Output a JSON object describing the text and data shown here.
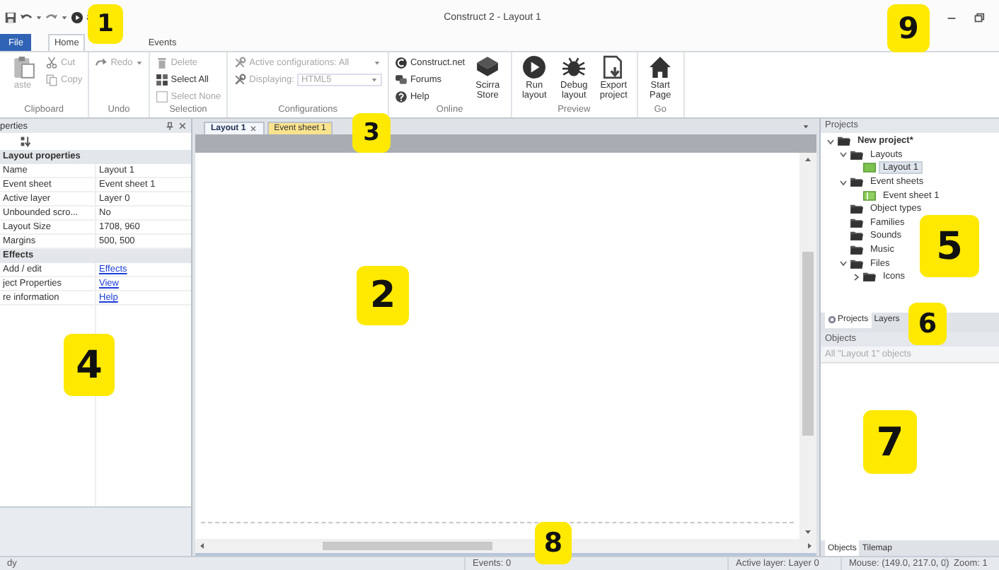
{
  "window": {
    "title": "Construct 2 - Layout 1"
  },
  "ribbon_tabs": [
    {
      "label": "File",
      "kind": "file",
      "selected": false
    },
    {
      "label": "Home",
      "kind": "tab",
      "selected": true
    },
    {
      "label": "Events",
      "kind": "tab",
      "selected": false
    }
  ],
  "ribbon_groups": [
    {
      "label": "Clipboard",
      "columns": [
        [
          {
            "label": "aste",
            "kind": "large",
            "disabled": true
          }
        ],
        [
          {
            "label": "Cut",
            "kind": "small",
            "disabled": true
          },
          {
            "label": "Copy",
            "kind": "small",
            "disabled": true
          }
        ]
      ]
    },
    {
      "label": "Undo",
      "columns": [
        [
          {
            "label": "Redo",
            "kind": "split",
            "disabled": true
          }
        ]
      ]
    },
    {
      "label": "Selection",
      "columns": [
        [
          {
            "label": "Delete",
            "kind": "small",
            "disabled": true
          },
          {
            "label": "Select All",
            "kind": "small",
            "disabled": false
          },
          {
            "label": "Select None",
            "kind": "small",
            "disabled": true
          }
        ]
      ]
    },
    {
      "label": "Configurations",
      "columns": [
        [
          {
            "label": "Active configurations: All",
            "kind": "dropdown",
            "disabled": true
          },
          {
            "label": "Displaying:",
            "value": "HTML5",
            "kind": "combo",
            "disabled": true
          }
        ]
      ]
    },
    {
      "label": "Online",
      "columns": [
        [
          {
            "label": "Construct.net",
            "kind": "small",
            "disabled": false
          },
          {
            "label": "Forums",
            "kind": "small",
            "disabled": false
          },
          {
            "label": "Help",
            "kind": "small",
            "disabled": false
          }
        ],
        [
          {
            "label": "Scirra Store",
            "kind": "large",
            "disabled": false
          }
        ]
      ]
    },
    {
      "label": "Preview",
      "columns": [
        [
          {
            "label": "Run layout",
            "kind": "large",
            "disabled": false
          }
        ],
        [
          {
            "label": "Debug layout",
            "kind": "large",
            "disabled": false
          }
        ],
        [
          {
            "label": "Export project",
            "kind": "large",
            "disabled": false
          }
        ]
      ]
    },
    {
      "label": "Go",
      "columns": [
        [
          {
            "label": "Start Page",
            "kind": "large",
            "disabled": false
          }
        ]
      ]
    }
  ],
  "properties_panel": {
    "title": "perties",
    "rows": [
      {
        "kind": "category",
        "name": "Layout properties"
      },
      {
        "kind": "property",
        "name": "Name",
        "value": "Layout 1"
      },
      {
        "kind": "property",
        "name": "Event sheet",
        "value": "Event sheet 1"
      },
      {
        "kind": "property",
        "name": "Active layer",
        "value": "Layer 0"
      },
      {
        "kind": "property",
        "name": "Unbounded scro...",
        "value": "No"
      },
      {
        "kind": "property",
        "name": "Layout Size",
        "value": "1708, 960"
      },
      {
        "kind": "property",
        "name": "Margins",
        "value": "500, 500"
      },
      {
        "kind": "category",
        "name": "Effects"
      },
      {
        "kind": "link",
        "name": "Add / edit",
        "value": "Effects"
      },
      {
        "kind": "link",
        "name": "ject Properties",
        "value": "View"
      },
      {
        "kind": "link",
        "name": "re information",
        "value": "Help"
      }
    ]
  },
  "document_tabs": [
    {
      "label": "Layout 1",
      "kind": "layout",
      "selected": true
    },
    {
      "label": "Event sheet 1",
      "kind": "event_sheet",
      "selected": false
    }
  ],
  "projects_panel": {
    "title": "Projects",
    "tree": [
      {
        "label": "New project*",
        "kind": "folder",
        "selected": false,
        "expanded": true,
        "children": [
          {
            "label": "Layouts",
            "kind": "folder",
            "selected": false,
            "expanded": true,
            "children": [
              {
                "label": "Layout 1",
                "kind": "layout",
                "selected": true
              }
            ]
          },
          {
            "label": "Event sheets",
            "kind": "folder",
            "selected": false,
            "expanded": true,
            "children": [
              {
                "label": "Event sheet 1",
                "kind": "event_sheet",
                "selected": false
              }
            ]
          },
          {
            "label": "Object types",
            "kind": "folder",
            "selected": false
          },
          {
            "label": "Families",
            "kind": "folder",
            "selected": false
          },
          {
            "label": "Sounds",
            "kind": "folder",
            "selected": false
          },
          {
            "label": "Music",
            "kind": "folder",
            "selected": false
          },
          {
            "label": "Files",
            "kind": "folder",
            "selected": false,
            "expanded": true,
            "children": [
              {
                "label": "Icons",
                "kind": "folder",
                "selected": false,
                "expanded": false
              }
            ]
          }
        ]
      }
    ],
    "tabs": [
      {
        "label": "Projects",
        "selected": true
      },
      {
        "label": "Layers",
        "selected": false
      }
    ]
  },
  "objects_panel": {
    "title": "Objects",
    "filter": {
      "placeholder": "All \"Layout 1\" objects"
    },
    "tabs": [
      {
        "label": "Objects",
        "selected": true
      },
      {
        "label": "Tilemap",
        "selected": false
      }
    ]
  },
  "status_bar": [
    {
      "text": "dy"
    },
    {
      "text": "Events: 0"
    },
    {
      "text": "Active layer: Layer 0"
    },
    {
      "text": "Mouse: (149.0, 217.0, 0)"
    },
    {
      "text": "Zoom: 1"
    }
  ],
  "callouts": [
    {
      "label": "1"
    },
    {
      "label": "2"
    },
    {
      "label": "3"
    },
    {
      "label": "4"
    },
    {
      "label": "5"
    },
    {
      "label": "6"
    },
    {
      "label": "7"
    },
    {
      "label": "8"
    },
    {
      "label": "9"
    }
  ]
}
